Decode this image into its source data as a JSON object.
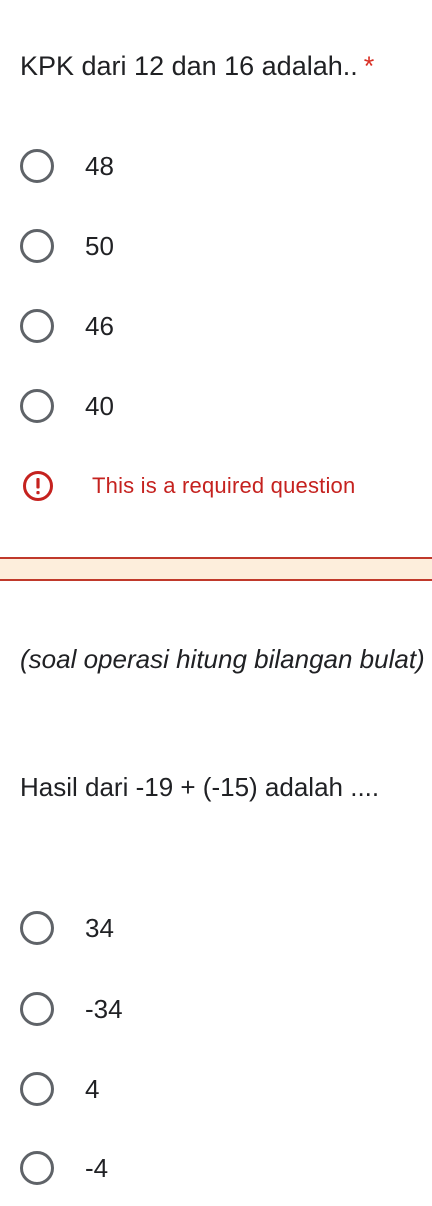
{
  "question1": {
    "title": "KPK dari 12 dan 16 adalah..",
    "required_marker": "*",
    "options": [
      "48",
      "50",
      "46",
      "40"
    ],
    "error_text": "This is a required question",
    "error_icon": "exclamation-circle-icon"
  },
  "question2": {
    "note": "(soal operasi hitung bilangan bulat)",
    "title": "Hasil dari -19 + (-15) adalah ....",
    "options": [
      "34",
      "-34",
      "4",
      "-4"
    ]
  },
  "colors": {
    "error": "#c5221f",
    "required_star": "#d93025",
    "radio_border": "#5f6368",
    "divider_band": "#fdeedc"
  }
}
